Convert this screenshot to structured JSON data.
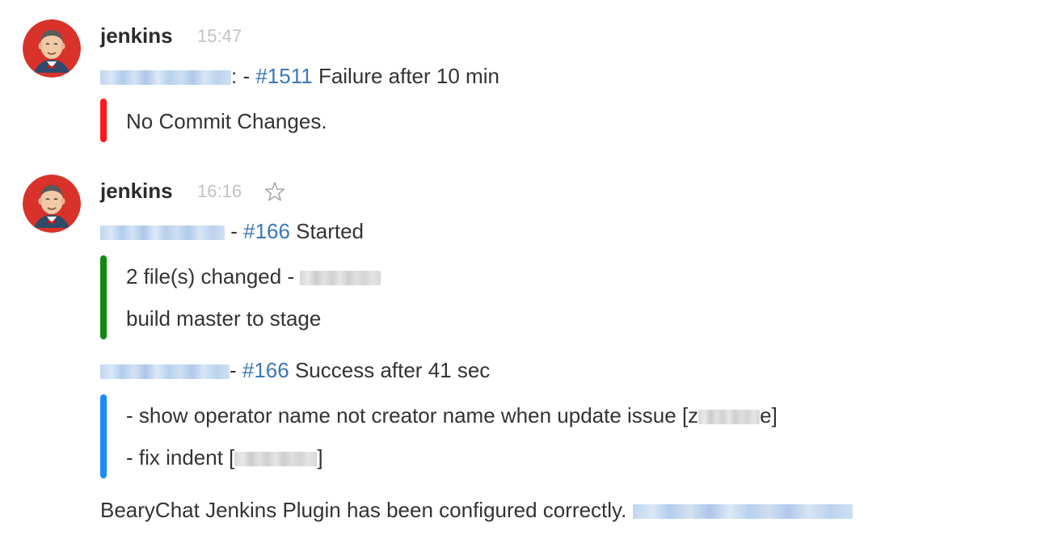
{
  "colors": {
    "link": "#3b78b8",
    "bar_failure": "#ff1a1a",
    "bar_started": "#0f8a0f",
    "bar_success": "#1a8cff",
    "timestamp": "#c2c2c2"
  },
  "messages": [
    {
      "sender": "jenkins",
      "time": "15:47",
      "lines": [
        {
          "job_suffix": ":",
          "separator": " - ",
          "build_link": "#1511",
          "status_text": " Failure after 10 min",
          "attachment": {
            "bar_color": "red",
            "rows": [
              {
                "text": "No Commit Changes."
              }
            ]
          }
        }
      ]
    },
    {
      "sender": "jenkins",
      "time": "16:16",
      "star_icon": "star-outline-icon",
      "lines": [
        {
          "separator": " - ",
          "build_link": "#166",
          "status_text": " Started",
          "attachment": {
            "bar_color": "green",
            "rows": [
              {
                "text": "2 file(s) changed - "
              },
              {
                "text": "build master to stage"
              }
            ]
          }
        },
        {
          "separator": "- ",
          "build_link": "#166",
          "status_text": " Success after 41 sec",
          "attachment": {
            "bar_color": "blue",
            "rows": [
              {
                "text": "- show operator name not creator name when update issue [z",
                "suffix": "e]"
              },
              {
                "text": "- fix indent [",
                "suffix": "]"
              }
            ]
          }
        }
      ],
      "footer": "BearyChat Jenkins Plugin has been configured correctly. "
    }
  ]
}
